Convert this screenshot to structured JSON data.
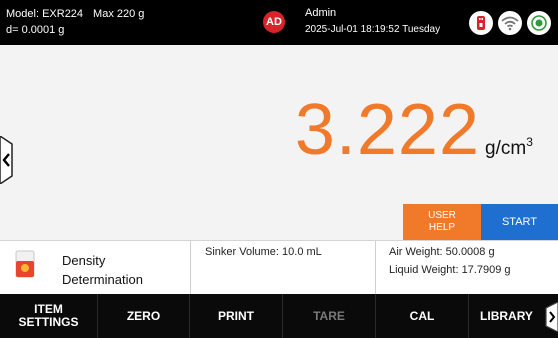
{
  "header": {
    "model": "Model: EXR224",
    "max": "Max 220 g",
    "resolution": "d= 0.0001 g",
    "user_initials": "AD",
    "user_name": "Admin",
    "datetime": "2025-Jul-01 18:19:52 Tuesday",
    "status_icons": [
      "usb-icon",
      "wifi-icon",
      "record-icon"
    ]
  },
  "display": {
    "value": "3.222",
    "unit": "g/cm",
    "unit_exponent": "3"
  },
  "actions": {
    "help_label_1": "USER",
    "help_label_2": "HELP",
    "start_label": "START"
  },
  "info": {
    "method_line1": "Density",
    "method_line2": "Determination",
    "sinker_volume": "Sinker Volume: 10.0 mL",
    "air_weight": "Air Weight: 50.0008 g",
    "liquid_weight": "Liquid Weight: 17.7909 g"
  },
  "toolbar": {
    "item_settings_1": "ITEM",
    "item_settings_2": "SETTINGS",
    "zero": "ZERO",
    "print": "PRINT",
    "tare": "TARE",
    "cal": "CAL",
    "library": "LIBRARY"
  },
  "colors": {
    "accent_orange": "#f07a2a",
    "start_blue": "#1f6fd0",
    "avatar_red": "#d8232a",
    "bar_black": "#000000"
  }
}
